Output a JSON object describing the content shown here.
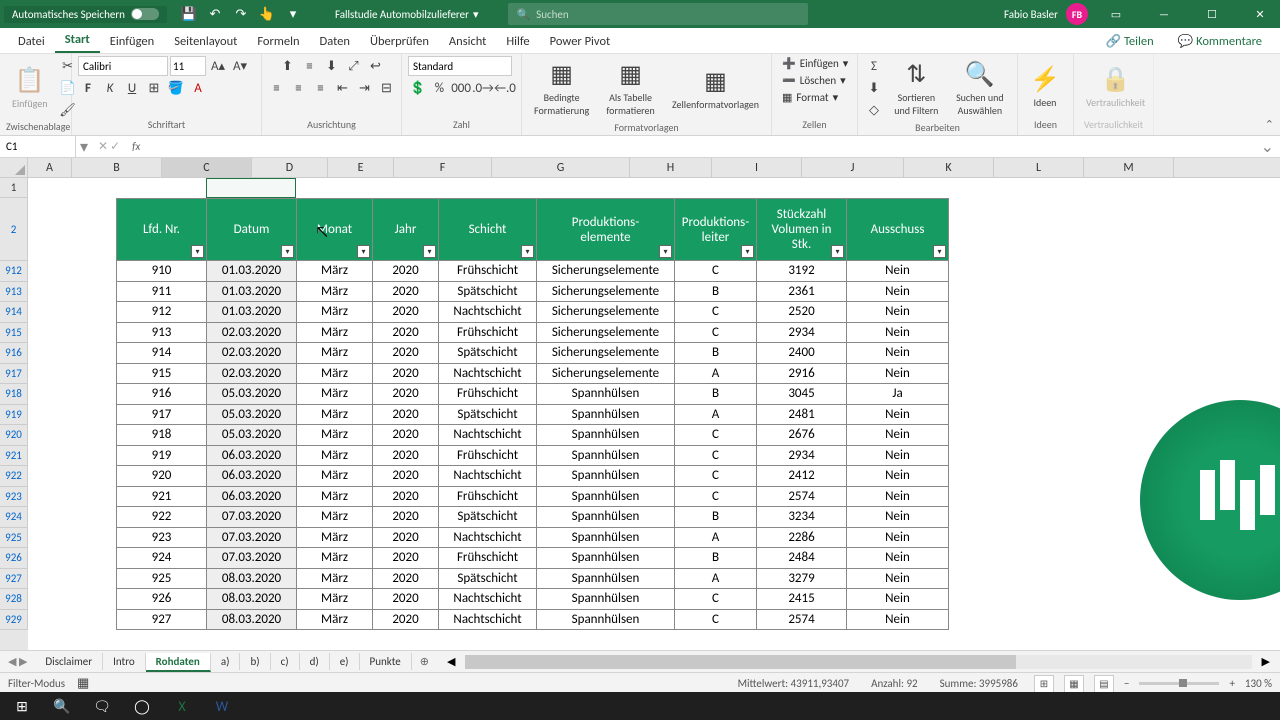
{
  "titlebar": {
    "autosave": "Automatisches Speichern",
    "filename": "Fallstudie Automobilzulieferer",
    "search_placeholder": "Suchen",
    "user": "Fabio Basler",
    "user_initials": "FB"
  },
  "tabs": {
    "datei": "Datei",
    "start": "Start",
    "einfuegen": "Einfügen",
    "seitenlayout": "Seitenlayout",
    "formeln": "Formeln",
    "daten": "Daten",
    "ueberpruefen": "Überprüfen",
    "ansicht": "Ansicht",
    "hilfe": "Hilfe",
    "powerpivot": "Power Pivot",
    "teilen": "Teilen",
    "kommentare": "Kommentare"
  },
  "ribbon": {
    "g1": "Zwischenablage",
    "g1_paste": "Einfügen",
    "g2": "Schriftart",
    "font": "Calibri",
    "size": "11",
    "g3": "Ausrichtung",
    "g4": "Zahl",
    "g4_format": "Standard",
    "g5": "Formatvorlagen",
    "g5_cond": "Bedingte Formatierung",
    "g5_table": "Als Tabelle formatieren",
    "g5_cell": "Zellenformatvorlagen",
    "g6": "Zellen",
    "g6_ins": "Einfügen",
    "g6_del": "Löschen",
    "g6_fmt": "Format",
    "g7": "Bearbeiten",
    "g7_sort": "Sortieren und Filtern",
    "g7_find": "Suchen und Auswählen",
    "g8": "Ideen",
    "g8_btn": "Ideen",
    "g9": "Vertraulichkeit",
    "g9_btn": "Vertraulichkeit"
  },
  "formula": {
    "namebox": "C1"
  },
  "cols": [
    "A",
    "B",
    "C",
    "D",
    "E",
    "F",
    "G",
    "H",
    "I",
    "J",
    "K",
    "L",
    "M"
  ],
  "rows_first": "1",
  "rows_second": "2",
  "row_nums": [
    "912",
    "913",
    "914",
    "915",
    "916",
    "917",
    "918",
    "919",
    "920",
    "921",
    "922",
    "923",
    "924",
    "925",
    "926",
    "927",
    "928",
    "929"
  ],
  "headers": [
    "Lfd. Nr.",
    "Datum",
    "Monat",
    "Jahr",
    "Schicht",
    "Produktions-elemente",
    "Produktions-leiter",
    "Stückzahl Volumen in Stk.",
    "Ausschuss"
  ],
  "data": [
    [
      "910",
      "01.03.2020",
      "März",
      "2020",
      "Frühschicht",
      "Sicherungselemente",
      "C",
      "3192",
      "Nein"
    ],
    [
      "911",
      "01.03.2020",
      "März",
      "2020",
      "Spätschicht",
      "Sicherungselemente",
      "B",
      "2361",
      "Nein"
    ],
    [
      "912",
      "01.03.2020",
      "März",
      "2020",
      "Nachtschicht",
      "Sicherungselemente",
      "C",
      "2520",
      "Nein"
    ],
    [
      "913",
      "02.03.2020",
      "März",
      "2020",
      "Frühschicht",
      "Sicherungselemente",
      "C",
      "2934",
      "Nein"
    ],
    [
      "914",
      "02.03.2020",
      "März",
      "2020",
      "Spätschicht",
      "Sicherungselemente",
      "B",
      "2400",
      "Nein"
    ],
    [
      "915",
      "02.03.2020",
      "März",
      "2020",
      "Nachtschicht",
      "Sicherungselemente",
      "A",
      "2916",
      "Nein"
    ],
    [
      "916",
      "05.03.2020",
      "März",
      "2020",
      "Frühschicht",
      "Spannhülsen",
      "B",
      "3045",
      "Ja"
    ],
    [
      "917",
      "05.03.2020",
      "März",
      "2020",
      "Spätschicht",
      "Spannhülsen",
      "A",
      "2481",
      "Nein"
    ],
    [
      "918",
      "05.03.2020",
      "März",
      "2020",
      "Nachtschicht",
      "Spannhülsen",
      "C",
      "2676",
      "Nein"
    ],
    [
      "919",
      "06.03.2020",
      "März",
      "2020",
      "Frühschicht",
      "Spannhülsen",
      "C",
      "2934",
      "Nein"
    ],
    [
      "920",
      "06.03.2020",
      "März",
      "2020",
      "Nachtschicht",
      "Spannhülsen",
      "C",
      "2412",
      "Nein"
    ],
    [
      "921",
      "06.03.2020",
      "März",
      "2020",
      "Frühschicht",
      "Spannhülsen",
      "C",
      "2574",
      "Nein"
    ],
    [
      "922",
      "07.03.2020",
      "März",
      "2020",
      "Spätschicht",
      "Spannhülsen",
      "B",
      "3234",
      "Nein"
    ],
    [
      "923",
      "07.03.2020",
      "März",
      "2020",
      "Nachtschicht",
      "Spannhülsen",
      "A",
      "2286",
      "Nein"
    ],
    [
      "924",
      "07.03.2020",
      "März",
      "2020",
      "Frühschicht",
      "Spannhülsen",
      "B",
      "2484",
      "Nein"
    ],
    [
      "925",
      "08.03.2020",
      "März",
      "2020",
      "Spätschicht",
      "Spannhülsen",
      "A",
      "3279",
      "Nein"
    ],
    [
      "926",
      "08.03.2020",
      "März",
      "2020",
      "Nachtschicht",
      "Spannhülsen",
      "C",
      "2415",
      "Nein"
    ],
    [
      "927",
      "08.03.2020",
      "März",
      "2020",
      "Nachtschicht",
      "Spannhülsen",
      "C",
      "2574",
      "Nein"
    ]
  ],
  "sheets": {
    "nav": "◀ ▶",
    "list": [
      "Disclaimer",
      "Intro",
      "Rohdaten",
      "a)",
      "b)",
      "c)",
      "d)",
      "e)",
      "Punkte"
    ],
    "active_index": 2
  },
  "status": {
    "mode": "Filter-Modus",
    "avg_label": "Mittelwert:",
    "avg": "43911,93407",
    "cnt_label": "Anzahl:",
    "cnt": "92",
    "sum_label": "Summe:",
    "sum": "3995986",
    "zoom": "130 %"
  }
}
